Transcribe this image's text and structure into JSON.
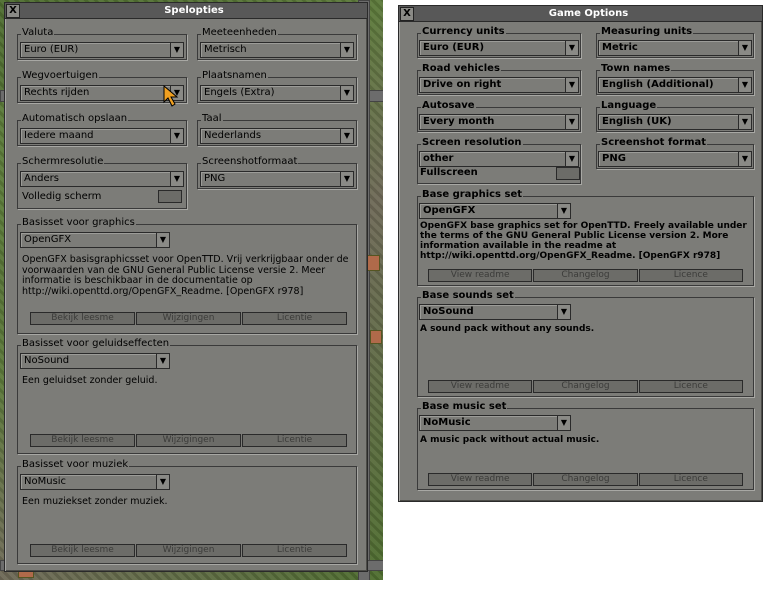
{
  "left": {
    "title": "Spelopties",
    "close": "X",
    "currency": {
      "label": "Valuta",
      "value": "Euro (EUR)"
    },
    "measuring": {
      "label": "Meeteenheden",
      "value": "Metrisch"
    },
    "road": {
      "label": "Wegvoertuigen",
      "value": "Rechts rijden"
    },
    "town": {
      "label": "Plaatsnamen",
      "value": "Engels (Extra)"
    },
    "autosave": {
      "label": "Automatisch opslaan",
      "value": "Iedere maand"
    },
    "language": {
      "label": "Taal",
      "value": "Nederlands"
    },
    "resolution": {
      "label": "Schermresolutie",
      "value": "Anders",
      "fullscreen": "Volledig scherm"
    },
    "screenshot": {
      "label": "Screenshotformaat",
      "value": "PNG"
    },
    "graphics": {
      "label": "Basisset voor graphics",
      "value": "OpenGFX",
      "description": "OpenGFX basisgraphicsset voor OpenTTD. Vrij verkrijgbaar onder de voorwaarden van de GNU General Public License versie 2. Meer informatie is beschikbaar in de documentatie op http://wiki.openttd.org/OpenGFX_Readme. [OpenGFX r978]",
      "buttons": [
        "Bekijk leesme",
        "Wijzigingen",
        "Licentie"
      ]
    },
    "sounds": {
      "label": "Basisset voor geluidseffecten",
      "value": "NoSound",
      "description": "Een geluidset zonder geluid.",
      "buttons": [
        "Bekijk leesme",
        "Wijzigingen",
        "Licentie"
      ]
    },
    "music": {
      "label": "Basisset voor muziek",
      "value": "NoMusic",
      "description": "Een muziekset zonder muziek.",
      "buttons": [
        "Bekijk leesme",
        "Wijzigingen",
        "Licentie"
      ]
    }
  },
  "right": {
    "title": "Game Options",
    "close": "X",
    "currency": {
      "label": "Currency units",
      "value": "Euro (EUR)"
    },
    "measuring": {
      "label": "Measuring units",
      "value": "Metric"
    },
    "road": {
      "label": "Road vehicles",
      "value": "Drive on right"
    },
    "town": {
      "label": "Town names",
      "value": "English (Additional)"
    },
    "autosave": {
      "label": "Autosave",
      "value": "Every month"
    },
    "language": {
      "label": "Language",
      "value": "English (UK)"
    },
    "resolution": {
      "label": "Screen resolution",
      "value": "other",
      "fullscreen": "Fullscreen"
    },
    "screenshot": {
      "label": "Screenshot format",
      "value": "PNG"
    },
    "graphics": {
      "label": "Base graphics set",
      "value": "OpenGFX",
      "description": "OpenGFX base graphics set for OpenTTD. Freely available under the terms of the GNU General Public License version 2. More information available in the readme at http://wiki.openttd.org/OpenGFX_Readme. [OpenGFX r978]",
      "buttons": [
        "View readme",
        "Changelog",
        "Licence"
      ]
    },
    "sounds": {
      "label": "Base sounds set",
      "value": "NoSound",
      "description": "A sound pack without any sounds.",
      "buttons": [
        "View readme",
        "Changelog",
        "Licence"
      ]
    },
    "music": {
      "label": "Base music set",
      "value": "NoMusic",
      "description": "A music pack without actual music.",
      "buttons": [
        "View readme",
        "Changelog",
        "Licence"
      ]
    }
  },
  "icons": {
    "dropdown": "dropdown-arrow-icon",
    "close": "close-icon",
    "cursor": "mouse-cursor-icon"
  },
  "colors": {
    "window": "#7c7c78",
    "titlebar": "#585858",
    "border": "#2a2a2a",
    "grass": "#5d7a3b"
  }
}
